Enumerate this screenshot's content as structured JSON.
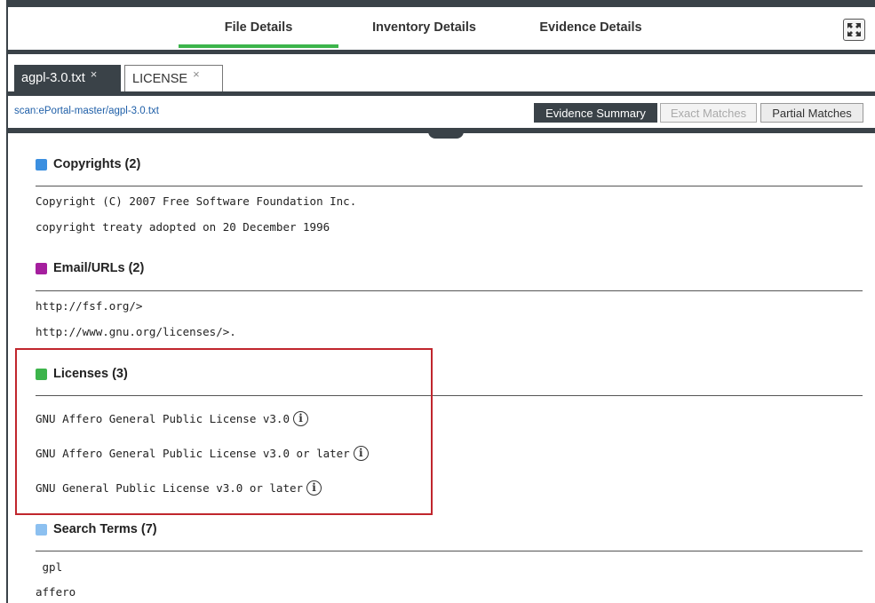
{
  "header": {
    "tabs": [
      {
        "label": "File Details",
        "active": true
      },
      {
        "label": "Inventory Details",
        "active": false
      },
      {
        "label": "Evidence Details",
        "active": false
      }
    ],
    "expand_icon": "expand-arrows-icon"
  },
  "files": {
    "tabs": [
      {
        "label": "agpl-3.0.txt",
        "active": true
      },
      {
        "label": "LICENSE",
        "active": false
      }
    ],
    "close_glyph": "×"
  },
  "path": "scan:ePortal-master/agpl-3.0.txt",
  "evidence_buttons": [
    {
      "label": "Evidence Summary",
      "state": "active"
    },
    {
      "label": "Exact Matches",
      "state": "disabled"
    },
    {
      "label": "Partial Matches",
      "state": "normal"
    }
  ],
  "sections": {
    "copyrights": {
      "title": "Copyrights (2)",
      "color": "#3b8fe0",
      "items": [
        "Copyright (C) 2007 Free Software Foundation Inc.",
        "copyright treaty adopted on 20 December 1996"
      ]
    },
    "emails": {
      "title": "Email/URLs (2)",
      "color": "#a51f9e",
      "items": [
        "http://fsf.org/>",
        "http://www.gnu.org/licenses/>."
      ]
    },
    "licenses": {
      "title": "Licenses (3)",
      "color": "#3cb44b",
      "items": [
        "GNU Affero General Public License v3.0",
        "GNU Affero General Public License v3.0 or later",
        "GNU General Public License v3.0 or later"
      ],
      "info_glyph": "i"
    },
    "search_terms": {
      "title": "Search Terms (7)",
      "color": "#8cc0f0",
      "items": [
        " gpl",
        "affero"
      ]
    }
  },
  "colors": {
    "dark": "#3a4248",
    "accent_green": "#3cb44b",
    "highlight_red": "#c0262d"
  }
}
